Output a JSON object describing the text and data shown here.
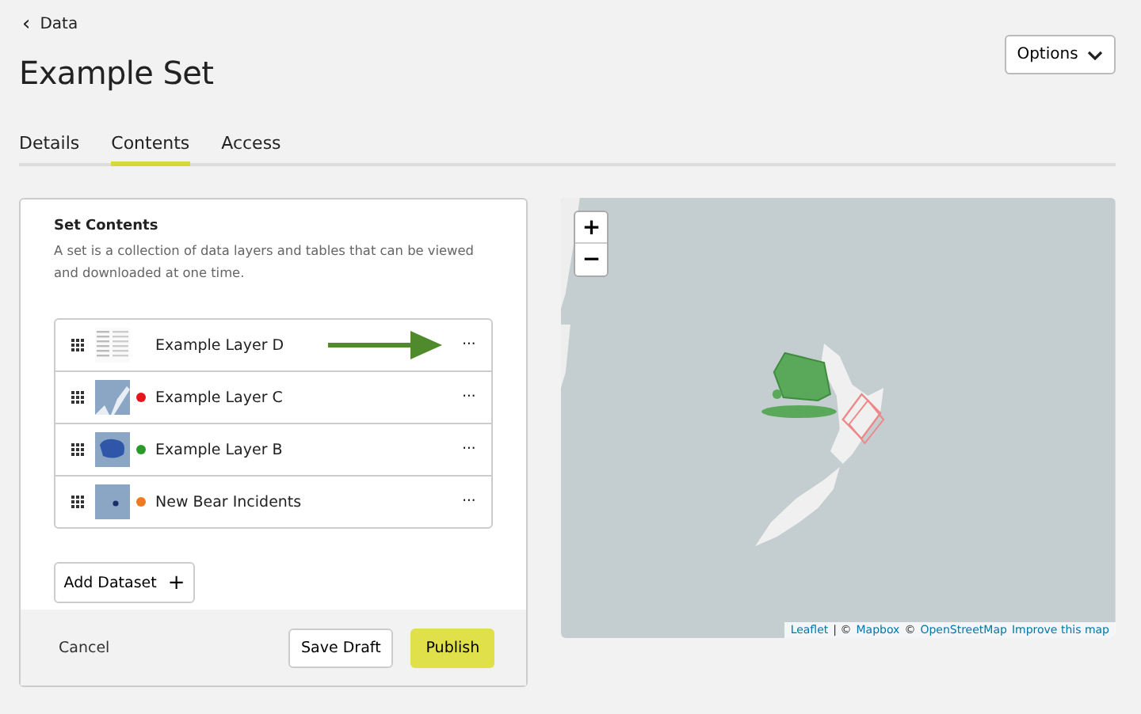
{
  "breadcrumb": {
    "icon": "‹",
    "label": "Data"
  },
  "title": "Example Set",
  "options_button": {
    "label": "Options"
  },
  "tabs": [
    {
      "label": "Details",
      "selected": false
    },
    {
      "label": "Contents",
      "selected": true
    },
    {
      "label": "Access",
      "selected": false
    }
  ],
  "panel": {
    "heading": "Set Contents",
    "description": "A set is a collection of data layers and tables that can be viewed and downloaded at one time.",
    "layers": [
      {
        "name": "Example Layer D",
        "kind": "table",
        "arrow": true,
        "menu": "···"
      },
      {
        "name": "Example Layer C",
        "kind": "map",
        "color": "#e8141c",
        "arrow": false,
        "menu": "···"
      },
      {
        "name": "Example Layer B",
        "kind": "map",
        "color": "#2a9a2a",
        "arrow": false,
        "menu": "···"
      },
      {
        "name": "New Bear Incidents",
        "kind": "map",
        "color": "#f07a22",
        "arrow": false,
        "menu": "···"
      }
    ],
    "add_button": {
      "label": "Add Dataset",
      "icon": "+"
    },
    "footer": {
      "cancel": "Cancel",
      "save": "Save Draft",
      "publish": "Publish"
    }
  },
  "map": {
    "zoom_in": "+",
    "zoom_out": "−",
    "attribution": [
      {
        "kind": "link",
        "text": "Leaflet"
      },
      {
        "kind": "text",
        "text": "| ©"
      },
      {
        "kind": "link",
        "text": "Mapbox"
      },
      {
        "kind": "text",
        "text": "©"
      },
      {
        "kind": "link",
        "text": "OpenStreetMap"
      },
      {
        "kind": "link",
        "text": "Improve this map"
      }
    ]
  }
}
